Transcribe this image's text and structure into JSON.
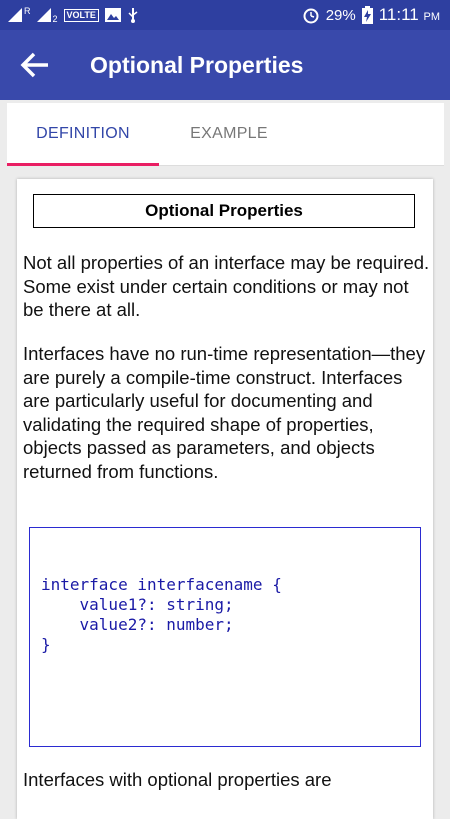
{
  "status_bar": {
    "volte": "VOLTE",
    "sim_r": "R",
    "sim_2": "2",
    "battery": "29%",
    "time": "11:11",
    "ampm": "PM",
    "icons": [
      "signal-icon",
      "image-icon",
      "usb-icon",
      "alarm-icon",
      "battery-charging-icon"
    ]
  },
  "app_bar": {
    "title": "Optional Properties",
    "back_icon": "arrow-back-icon"
  },
  "tabs": [
    {
      "label": "DEFINITION",
      "active": true
    },
    {
      "label": "EXAMPLE",
      "active": false
    }
  ],
  "content": {
    "heading": "Optional Properties",
    "paragraph1": " Not all properties of an interface may be required. Some exist under certain conditions or may not be there at all.",
    "paragraph2": " Interfaces have no run-time representation—they are purely a compile-time construct. Interfaces are particularly useful for documenting and validating the required shape of properties, objects passed as parameters, and objects returned from functions.",
    "code": "interface interfacename {\n    value1?: string;\n    value2?: number;\n}",
    "paragraph3": " Interfaces with optional properties are"
  },
  "colors": {
    "status_bar": "#2e3fa0",
    "app_bar": "#3949ab",
    "tab_active": "#3246a8",
    "tab_indicator": "#e91e63",
    "code_border": "#2b2bd1",
    "code_text": "#1a1aa6"
  }
}
